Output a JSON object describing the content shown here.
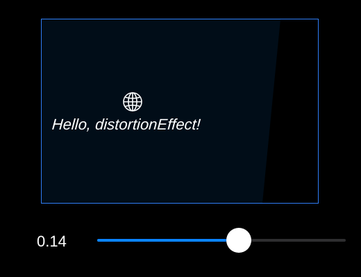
{
  "preview": {
    "greeting": "Hello, distortionEffect!",
    "icon": "globe-icon"
  },
  "slider": {
    "value_label": "0.14",
    "value": 0.14,
    "fraction": 0.57
  },
  "colors": {
    "accent": "#0a84ff",
    "frame_border": "#2f7df6",
    "preview_background": "#010d18",
    "track": "#2e2e30"
  }
}
